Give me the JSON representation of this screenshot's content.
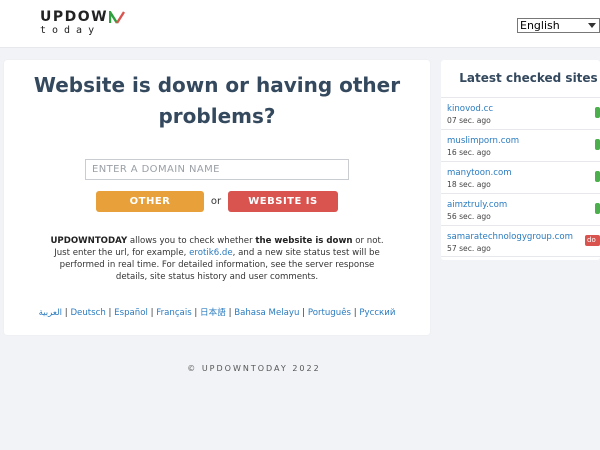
{
  "header": {
    "logo_main": "UPDOW",
    "logo_sub": "today",
    "logo_n_colors": [
      "#2e9e3e",
      "#d9534f"
    ],
    "language_select": {
      "selected": "English"
    }
  },
  "main": {
    "title": "Website is down or having other problems?",
    "search": {
      "placeholder": "ENTER A DOMAIN NAME",
      "value": ""
    },
    "buttons": {
      "other_problems": "OTHER PROBLEMS",
      "or": "or",
      "website_down": "WEBSITE IS DOWN"
    },
    "description": {
      "brand": "UPDOWNTODAY",
      "part1": " allows you to check whether ",
      "bold1": "the website is down",
      "part2": " or not. Just enter the url, for example, ",
      "example_link": "erotik6.de",
      "part3": ", and a new site status test will be performed in real time. For detailed information, see the server response details, site status history and user comments."
    },
    "languages": [
      "العربية",
      "Deutsch",
      "Español",
      "Français",
      "日本語",
      "Bahasa Melayu",
      "Português",
      "Русский"
    ],
    "language_separator": " | "
  },
  "sidebar": {
    "title": "Latest checked sites",
    "items": [
      {
        "domain": "kinovod.cc",
        "time": "07 sec. ago",
        "status": "up"
      },
      {
        "domain": "muslimporn.com",
        "time": "16 sec. ago",
        "status": "up"
      },
      {
        "domain": "manytoon.com",
        "time": "18 sec. ago",
        "status": "up"
      },
      {
        "domain": "aimztruly.com",
        "time": "56 sec. ago",
        "status": "up"
      },
      {
        "domain": "samaratechnologygroup.com",
        "time": "57 sec. ago",
        "status": "down",
        "badge": "do"
      }
    ]
  },
  "footer": {
    "text": "© UPDOWNTODAY 2022"
  },
  "colors": {
    "title": "#34495e",
    "link": "#2a7bbf",
    "orange": "#e8a13a",
    "red": "#d9534f",
    "green": "#4cae4c"
  }
}
